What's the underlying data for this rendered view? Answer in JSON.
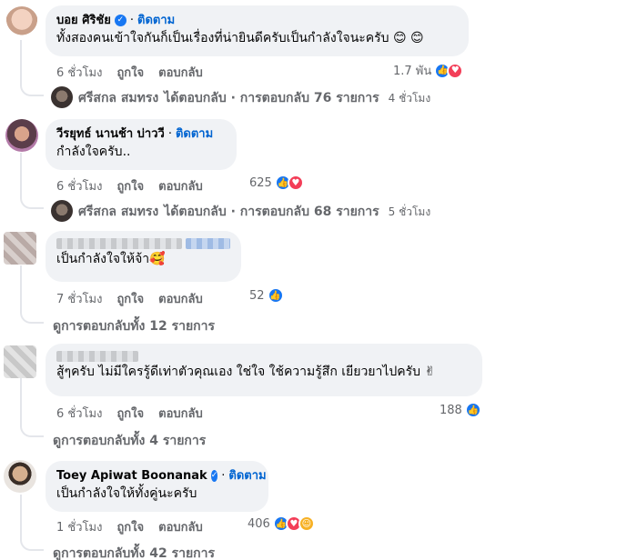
{
  "comments": [
    {
      "name": "บอย ศิริชัย",
      "follow": "ติดตาม",
      "text": "ทั้งสองคนเข้าใจกันก็เป็นเรื่องที่น่ายินดีครับเป็นกำลังใจนะครับ 😊 😊",
      "time": "6 ชั่วโมง",
      "like_label": "ถูกใจ",
      "reply_label": "ตอบกลับ",
      "reaction_count": "1.7 พัน",
      "reply_summary": {
        "name": "ศรีสกล สมทรง",
        "text": "ได้ตอบกลับ · การตอบกลับ 76 รายการ",
        "time": "4 ชั่วโมง"
      }
    },
    {
      "name": "วีรยุทธ์ นานช้า บ่าววี",
      "follow": "ติดตาม",
      "text": "กำลังใจครับ..",
      "time": "6 ชั่วโมง",
      "like_label": "ถูกใจ",
      "reply_label": "ตอบกลับ",
      "reaction_count": "625",
      "reply_summary": {
        "name": "ศรีสกล สมทรง",
        "text": "ได้ตอบกลับ · การตอบกลับ 68 รายการ",
        "time": "5 ชั่วโมง"
      }
    },
    {
      "text": "เป็นกำลังใจให้จ้า🥰",
      "time": "7 ชั่วโมง",
      "like_label": "ถูกใจ",
      "reply_label": "ตอบกลับ",
      "reaction_count": "52",
      "view_replies": "ดูการตอบกลับทั้ง 12 รายการ"
    },
    {
      "text": "สู้ๆครับ ไม่มีใครรู้ดีเท่าตัวคุณเอง ใช่ใจ ใช้ความรู้สึก เยียวยาไปครับ ✌",
      "time": "6 ชั่วโมง",
      "like_label": "ถูกใจ",
      "reply_label": "ตอบกลับ",
      "reaction_count": "188",
      "view_replies": "ดูการตอบกลับทั้ง 4 รายการ"
    },
    {
      "name": "Toey Apiwat Boonanak",
      "follow": "ติดตาม",
      "text": "เป็นกำลังใจให้ทั้งคู่นะครับ",
      "time": "1 ชั่วโมง",
      "like_label": "ถูกใจ",
      "reply_label": "ตอบกลับ",
      "reaction_count": "406",
      "view_replies": "ดูการตอบกลับทั้ง 42 รายการ"
    }
  ],
  "colors": {
    "bubble": "#f0f2f5",
    "link": "#0064d1",
    "like": "#1877f2",
    "love": "#f33e58",
    "muted": "#65676b"
  }
}
